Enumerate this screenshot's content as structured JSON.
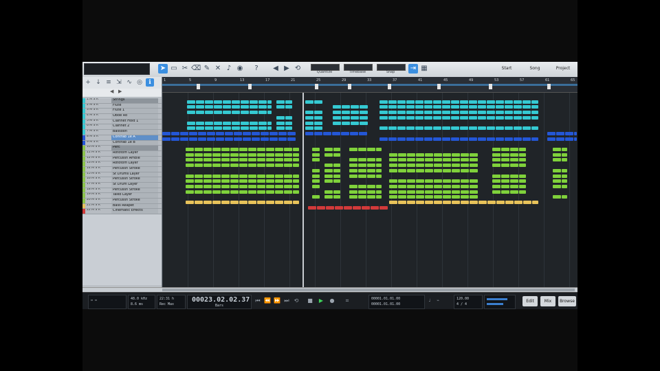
{
  "toolbar": {
    "tools": [
      "arrow",
      "range",
      "split",
      "eraser",
      "paint",
      "mute",
      "bend",
      "listen",
      "help"
    ],
    "quantize": "1/16",
    "timebase": "Bars",
    "snap": "Adaptive",
    "quantize_label": "Quantize",
    "timebase_label": "Timebase",
    "snap_label": "Snap",
    "right_buttons": [
      "Start",
      "Song",
      "Project"
    ]
  },
  "tracks": [
    {
      "label": "Strings",
      "nums": "1 M S R",
      "color": "#35c9d2",
      "folder": true
    },
    {
      "label": "Flute",
      "nums": "2 M S R",
      "color": "#35c9d2"
    },
    {
      "label": "Flute 1",
      "nums": "3 M S R",
      "color": "#35c9d2"
    },
    {
      "label": "Oboe Ro",
      "nums": "4 M S R",
      "color": "#35c9d2"
    },
    {
      "label": "Clarinet Hold 1",
      "nums": "5 M S R",
      "color": "#35c9d2"
    },
    {
      "label": "Clarinet 2",
      "nums": "6 M S R",
      "color": "#35c9d2"
    },
    {
      "label": "Bassoon",
      "nums": "7 M S R",
      "color": "#35c9d2"
    },
    {
      "label": "Contrab 1e A",
      "nums": "8 M S R",
      "color": "#2457d6",
      "selected": true
    },
    {
      "label": "Contrab 1e B",
      "nums": "9 M S R",
      "color": "#2457d6"
    },
    {
      "label": "Perc",
      "nums": "10 M S R",
      "color": "#8bc34a",
      "folder": true
    },
    {
      "label": "Rototom Layer",
      "nums": "11 M S R",
      "color": "#8bc34a"
    },
    {
      "label": "Percussn Ambie",
      "nums": "12 M S R",
      "color": "#8bc34a"
    },
    {
      "label": "Rototom Layer",
      "nums": "13 M S R",
      "color": "#8bc34a"
    },
    {
      "label": "Percussn Stroke",
      "nums": "14 M S R",
      "color": "#8bc34a"
    },
    {
      "label": "St Drums Layer",
      "nums": "15 M S R",
      "color": "#8bc34a"
    },
    {
      "label": "Percussn Stroke",
      "nums": "16 M S R",
      "color": "#8bc34a"
    },
    {
      "label": "St Drum Layer",
      "nums": "17 M S R",
      "color": "#8bc34a"
    },
    {
      "label": "Percussn Stroke",
      "nums": "18 M S R",
      "color": "#8bc34a"
    },
    {
      "label": "Taiko Layer",
      "nums": "19 M S R",
      "color": "#8bc34a"
    },
    {
      "label": "Percussn Stroke",
      "nums": "20 M S R",
      "color": "#8bc34a"
    },
    {
      "label": "Bass Reapet",
      "nums": "21 M S R",
      "color": "#e7c25a"
    },
    {
      "label": "Cinematic Effects",
      "nums": "22 M S R",
      "color": "#d23a3a"
    }
  ],
  "ruler_bars": [
    "1",
    "5",
    "9",
    "13",
    "17",
    "21",
    "25",
    "29",
    "33",
    "37",
    "41",
    "45",
    "49",
    "53",
    "57",
    "61",
    "65"
  ],
  "transport": {
    "sample_rate": "48.0 kHz",
    "bit_info": "8.6 ms",
    "record_max": "22:31 h",
    "record_label": "Rec Max",
    "time": "00023.02.02.37",
    "time_label": "Bars",
    "loop_start": "00001.01.01.00",
    "loop_end": "00001.01.01.00",
    "tempo": "120.00",
    "signature": "4 / 4",
    "side_buttons": [
      "Edit",
      "Mix",
      "Browse"
    ]
  },
  "colors": {
    "strings": "#35c9d2",
    "contrabass": "#2457d6",
    "perc": "#7fd13b",
    "bass": "#e7c25a",
    "effects": "#d23a3a"
  }
}
